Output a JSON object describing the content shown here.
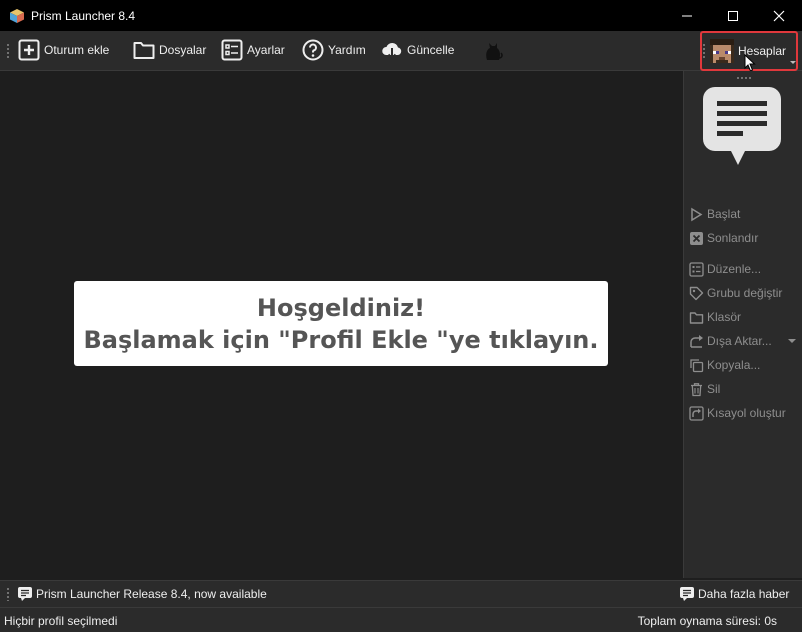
{
  "window": {
    "title": "Prism Launcher 8.4",
    "controls": [
      "minimize",
      "maximize",
      "close"
    ]
  },
  "toolbar": {
    "add_instance": "Oturum ekle",
    "folders": "Dosyalar",
    "settings": "Ayarlar",
    "help": "Yardım",
    "update": "Güncelle",
    "accounts": "Hesaplar",
    "accent_color": "#e0383c"
  },
  "welcome": {
    "line1": "Hoşgeldiniz!",
    "line2": "Başlamak için \"Profil Ekle \"ye tıklayın."
  },
  "instance_actions": {
    "items": [
      {
        "label": "Başlat",
        "icon": "play-icon"
      },
      {
        "label": "Sonlandır",
        "icon": "kill-icon"
      },
      {
        "label": "Düzenle...",
        "icon": "edit-icon"
      },
      {
        "label": "Grubu değiştir",
        "icon": "tag-icon"
      },
      {
        "label": "Klasör",
        "icon": "folder-icon"
      },
      {
        "label": "Dışa Aktar...",
        "icon": "export-icon"
      },
      {
        "label": "Kopyala...",
        "icon": "copy-icon"
      },
      {
        "label": "Sil",
        "icon": "trash-icon"
      },
      {
        "label": "Kısayol oluştur",
        "icon": "shortcut-icon"
      }
    ]
  },
  "news": {
    "headline": "Prism Launcher Release 8.4, now available",
    "more": "Daha fazla haber"
  },
  "status": {
    "selected": "Hiçbir profil seçilmedi",
    "playtime": "Toplam oynama süresi: 0s"
  }
}
